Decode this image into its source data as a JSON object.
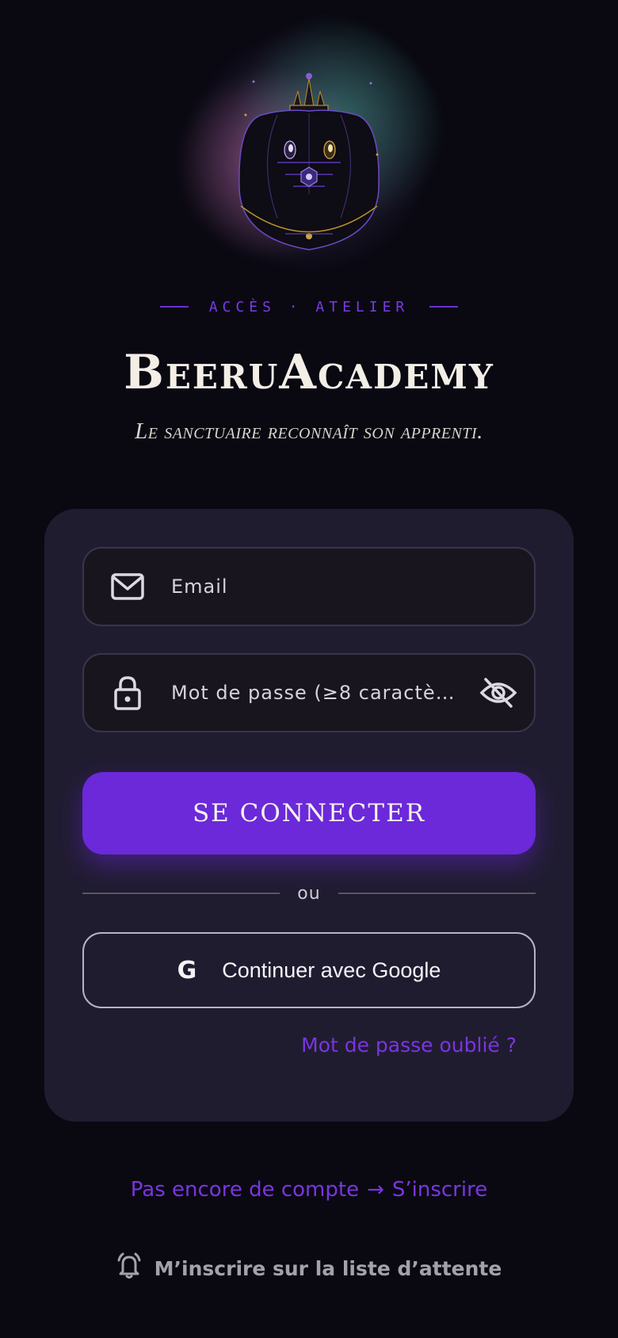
{
  "header": {
    "eyebrow": "ACCÈS · ATELIER",
    "title": "BeeruAcademy",
    "subtitle": "Le sanctuaire reconnaît son apprenti."
  },
  "form": {
    "email": {
      "placeholder": "Email",
      "value": ""
    },
    "password": {
      "placeholder": "Mot de passe (≥8 caractè…",
      "value": ""
    },
    "submit_label": "SE CONNECTER",
    "divider_label": "ou",
    "google_label": "Continuer avec Google",
    "google_glyph": "G",
    "forgot_label": "Mot de passe oublié ?"
  },
  "footer": {
    "no_account": "Pas encore de compte",
    "arrow": "→",
    "signup_label": "S’inscrire",
    "waitlist_label": "M’inscrire sur la liste d’attente"
  },
  "icons": {
    "email": "mail-icon",
    "password": "lock-icon",
    "visibility": "eye-off-icon",
    "google": "google-icon",
    "waitlist": "bell-alert-icon"
  },
  "colors": {
    "background": "#0a0912",
    "card": "#201c30",
    "accent": "#6b29da",
    "link": "#7a35e0"
  }
}
